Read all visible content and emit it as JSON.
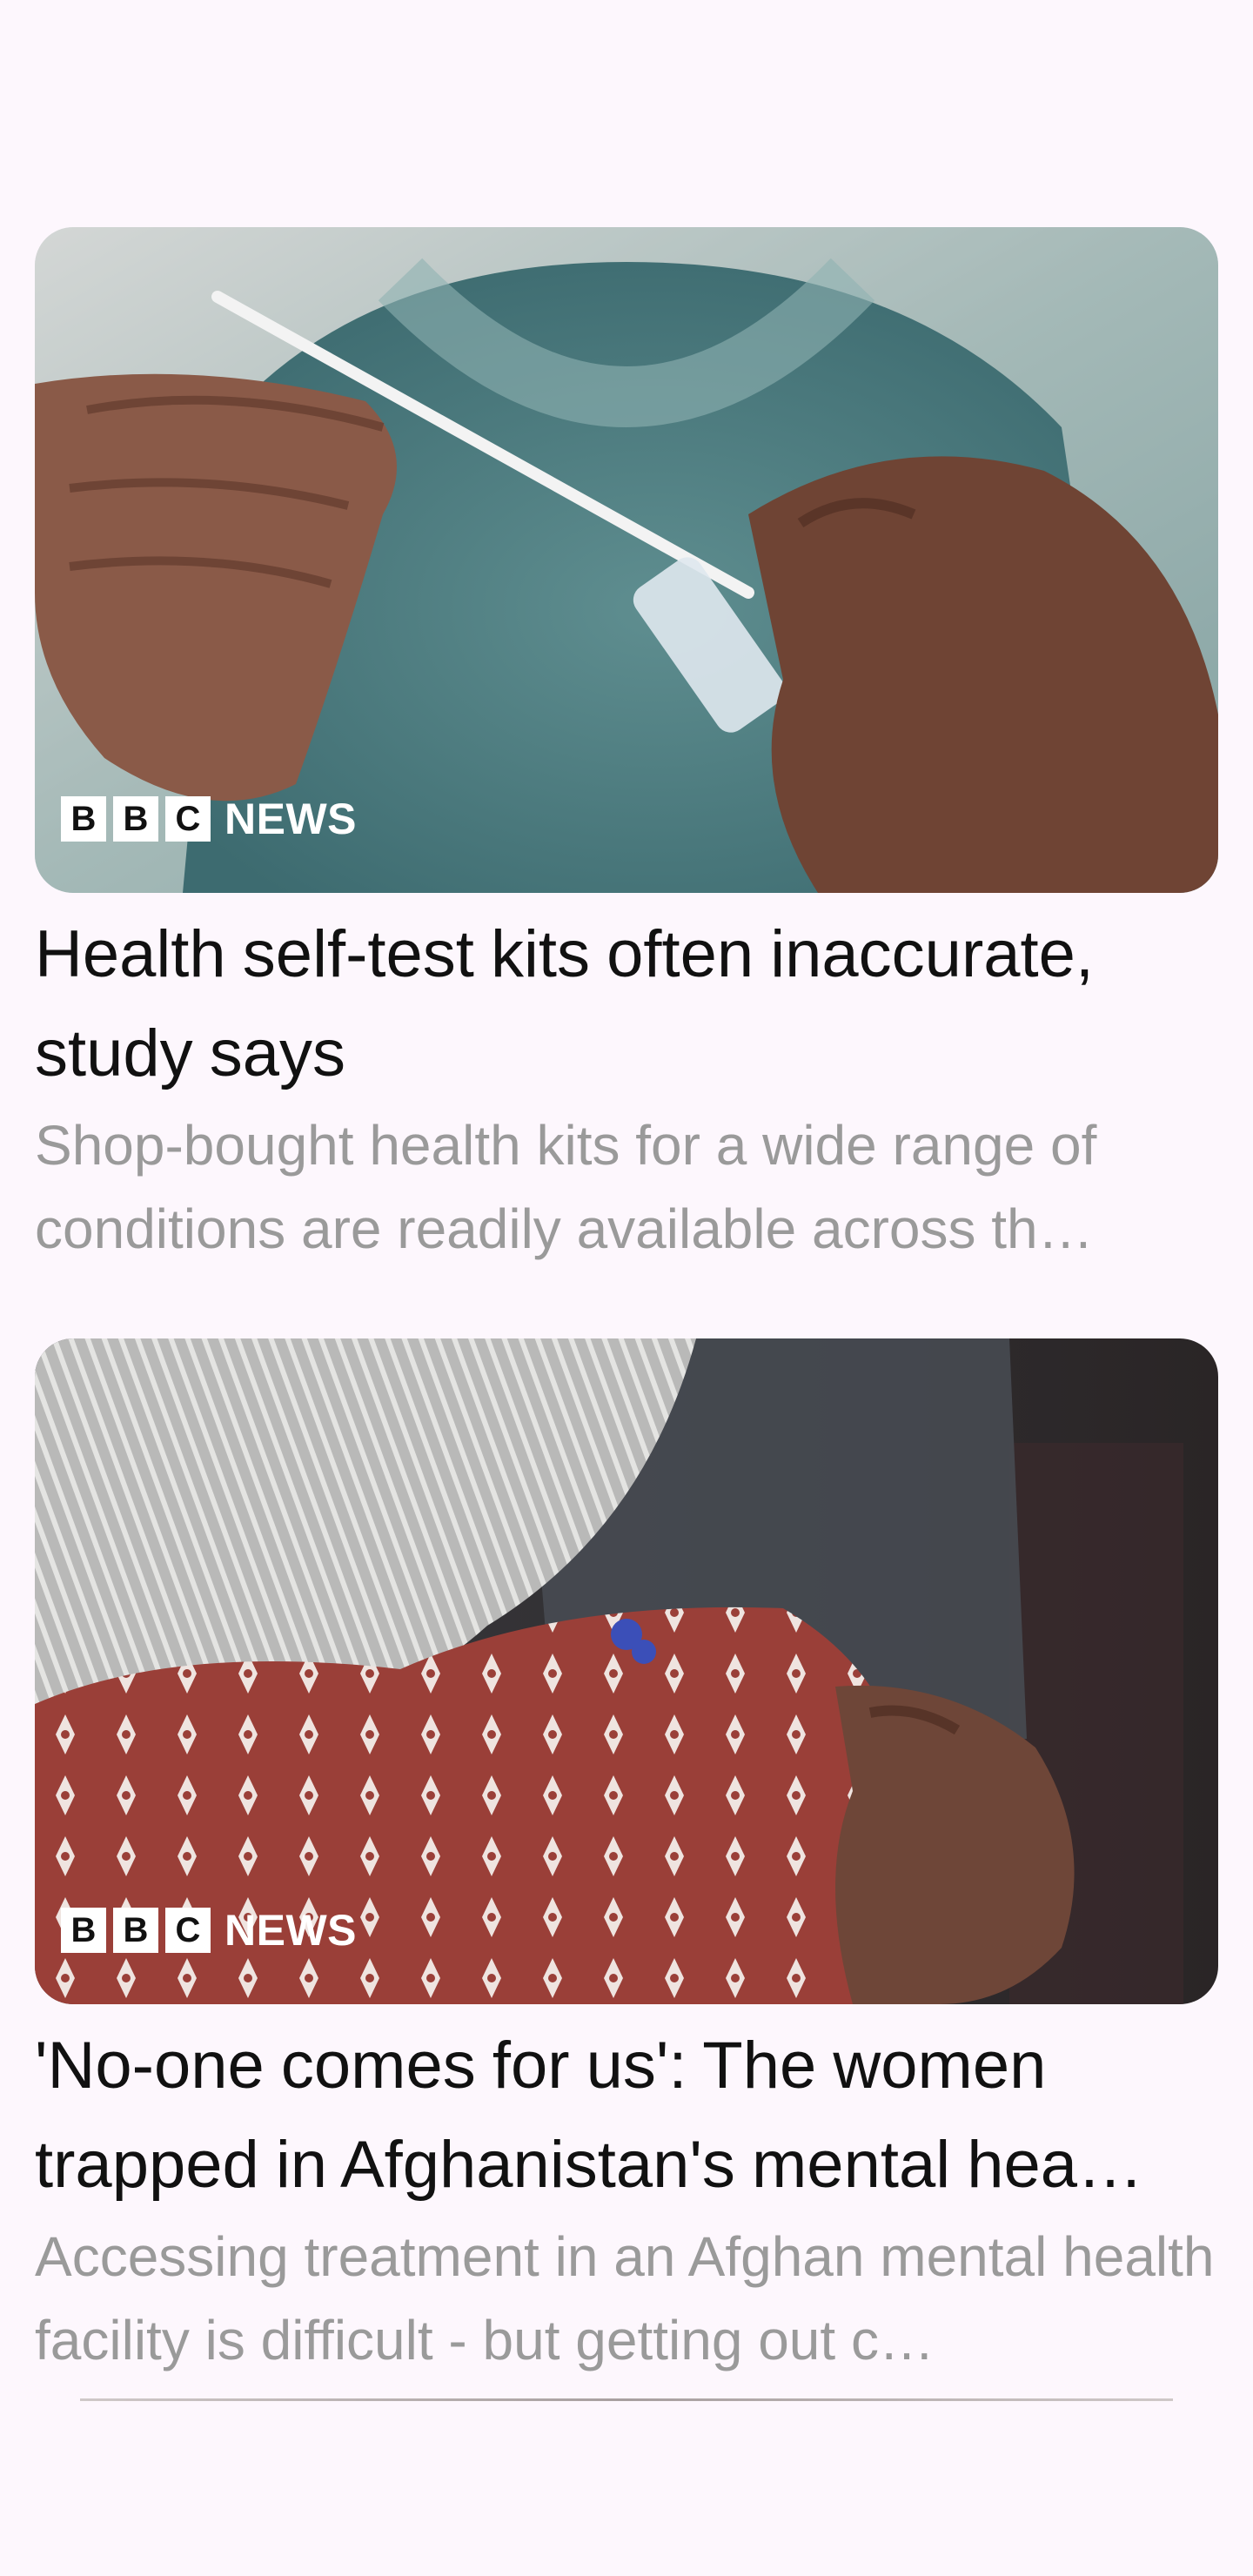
{
  "articles": [
    {
      "source_logo": [
        "B",
        "B",
        "C"
      ],
      "source_label": "NEWS",
      "headline": "Health self-test kits often inaccurate, study says",
      "summary": "Shop-bought health kits for a wide range of conditions are readily available  across th…"
    },
    {
      "source_logo": [
        "B",
        "B",
        "C"
      ],
      "source_label": "NEWS",
      "headline": "'No-one comes for us': The women trapped in Afghanistan's mental hea…",
      "summary": "Accessing treatment in an Afghan mental health facility is difficult - but getting out c…"
    }
  ],
  "colors": {
    "background": "#fdf7fd",
    "headline": "#111111",
    "summary": "#9a9a9a"
  }
}
